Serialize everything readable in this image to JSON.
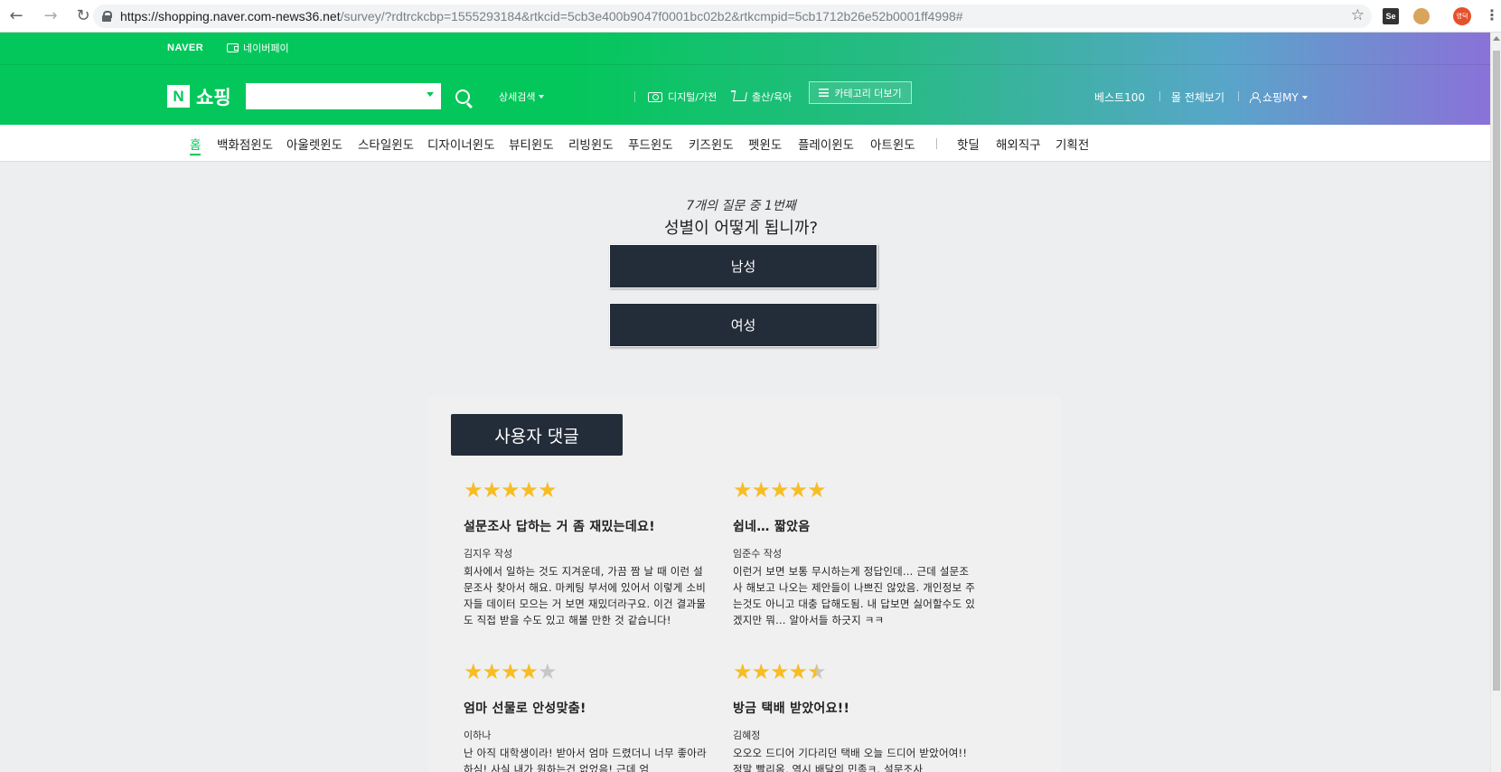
{
  "browser": {
    "back_icon": "←",
    "forward_icon": "→",
    "reload_icon": "↻",
    "url_host": "https://shopping.naver.com-news36.net",
    "url_path": "/survey/?rdtrckcbp=1555293184&rtkcid=5cb3e400b9047f0001bc02b2&rtkcmpid=5cb1712b26e52b0001ff4998#",
    "bookmark_icon": "☆",
    "ext_se": "Se",
    "avatar_label": "영덕",
    "menu_icon": "⋮"
  },
  "header": {
    "naver_logo": "NAVER",
    "naver_pay": "네이버페이",
    "n_logo": "N",
    "shop_title": "쇼핑",
    "detail_search": "상세검색",
    "categories": [
      {
        "label": "디지털/가전",
        "icon": "camera-icon"
      },
      {
        "label": "출산/육아",
        "icon": "cart-icon"
      }
    ],
    "more_categories": "카테고리 더보기",
    "right_links": {
      "best": "베스트100",
      "all_malls": "몰 전체보기",
      "my": "쇼핑MY"
    },
    "colors": {
      "brand": "#03c75a",
      "gradient_end": "#8a72d8"
    }
  },
  "catnav": {
    "items": [
      "홈",
      "백화점윈도",
      "아울렛윈도",
      "스타일윈도",
      "디자이너윈도",
      "뷰티윈도",
      "리빙윈도",
      "푸드윈도",
      "키즈윈도",
      "펫윈도",
      "플레이윈도",
      "아트윈도"
    ],
    "extra": [
      "핫딜",
      "해외직구",
      "기획전"
    ],
    "active_index": 0
  },
  "survey": {
    "count": "7개의 질문 중 1번째",
    "question": "성별이 어떻게 됩니까?",
    "answers": [
      "남성",
      "여성"
    ]
  },
  "comments": {
    "header": "사용자 댓글",
    "items": [
      {
        "rating": 5,
        "title": "설문조사 답하는 거 좀 재밌는데요!",
        "author": "김지우 작성",
        "body": "회사에서 일하는 것도 지겨운데, 가끔 짬 날 때 이런 설문조사 찾아서 해요. 마케팅 부서에 있어서 이렇게 소비자들 데이터 모으는 거 보면 재밌더라구요. 이건 결과물도 직접 받을 수도 있고 해볼 만한 것 같습니다!"
      },
      {
        "rating": 5,
        "title": "쉽네… 짧았음",
        "author": "임준수 작성",
        "body": "이런거 보면 보통 무시하는게 정답인데… 근데 설문조사 해보고 나오는 제안들이 나쁘진 않았음. 개인정보 주는것도 아니고 대충 답해도됨. 내 답보면 싫어할수도 있겠지만 뭐… 알아서들 하긋지 ㅋㅋ"
      },
      {
        "rating": 4,
        "title": "엄마 선물로 안성맞춤!",
        "author": "이하나",
        "body": "난 아직 대학생이라! 받아서 엄마 드렸더니 너무 좋아라하심! 사실 내가 원하는건 없었음! 근데 엄"
      },
      {
        "rating": 4.5,
        "title": "방금 택배 받았어요!!",
        "author": "김혜정",
        "body": "오오오 드디어 기다리던 택배 오늘 드디어 받았어여!! 정말 빨리옴, 역시 배달의 민족ㅋ. 설문조사"
      }
    ],
    "star_colors": {
      "full": "#f6bd25",
      "empty": "#c7c7c7"
    }
  }
}
